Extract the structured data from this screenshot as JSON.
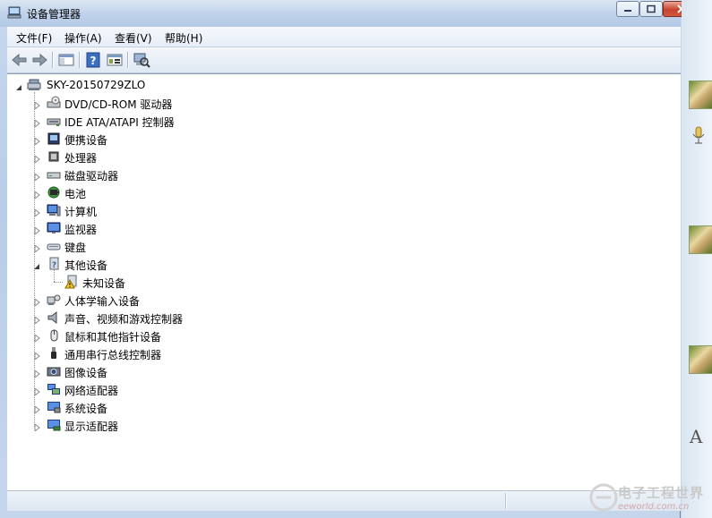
{
  "window": {
    "title": "设备管理器"
  },
  "menu": {
    "items": [
      "文件(F)",
      "操作(A)",
      "查看(V)",
      "帮助(H)"
    ]
  },
  "toolbar": {
    "icons": [
      "back-arrow-icon",
      "forward-arrow-icon",
      "show-hide-console-tree-icon",
      "help-icon",
      "properties-icon",
      "scan-hardware-icon"
    ]
  },
  "tree": {
    "root": "SKY-20150729ZLO",
    "nodes": [
      {
        "label": "DVD/CD-ROM 驱动器",
        "icon": "dvd-drive-icon",
        "expanded": false
      },
      {
        "label": "IDE ATA/ATAPI 控制器",
        "icon": "ide-controller-icon",
        "expanded": false
      },
      {
        "label": "便携设备",
        "icon": "portable-device-icon",
        "expanded": false
      },
      {
        "label": "处理器",
        "icon": "processor-icon",
        "expanded": false
      },
      {
        "label": "磁盘驱动器",
        "icon": "disk-drive-icon",
        "expanded": false
      },
      {
        "label": "电池",
        "icon": "battery-icon",
        "expanded": false
      },
      {
        "label": "计算机",
        "icon": "computer-icon",
        "expanded": false
      },
      {
        "label": "监视器",
        "icon": "monitor-icon",
        "expanded": false
      },
      {
        "label": "键盘",
        "icon": "keyboard-icon",
        "expanded": false
      },
      {
        "label": "其他设备",
        "icon": "other-devices-icon",
        "expanded": true,
        "children": [
          {
            "label": "未知设备",
            "icon": "unknown-device-warning-icon"
          }
        ]
      },
      {
        "label": "人体学输入设备",
        "icon": "hid-icon",
        "expanded": false
      },
      {
        "label": "声音、视频和游戏控制器",
        "icon": "sound-icon",
        "expanded": false
      },
      {
        "label": "鼠标和其他指针设备",
        "icon": "mouse-icon",
        "expanded": false
      },
      {
        "label": "通用串行总线控制器",
        "icon": "usb-icon",
        "expanded": false
      },
      {
        "label": "图像设备",
        "icon": "imaging-device-icon",
        "expanded": false
      },
      {
        "label": "网络适配器",
        "icon": "network-adapter-icon",
        "expanded": false
      },
      {
        "label": "系统设备",
        "icon": "system-device-icon",
        "expanded": false
      },
      {
        "label": "显示适配器",
        "icon": "display-adapter-icon",
        "expanded": false
      }
    ]
  },
  "right_panel": {
    "letter": "A"
  },
  "watermark": {
    "line1": "电子工程世界",
    "line2": "eeworld.com.cn"
  }
}
